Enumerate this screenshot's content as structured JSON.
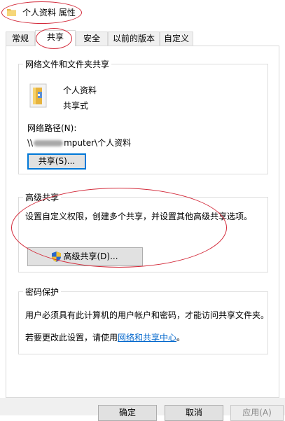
{
  "window": {
    "title": "个人资料 属性"
  },
  "tabs": [
    {
      "label": "常规"
    },
    {
      "label": "共享"
    },
    {
      "label": "安全"
    },
    {
      "label": "以前的版本"
    },
    {
      "label": "自定义"
    }
  ],
  "network_sharing": {
    "title": "网络文件和文件夹共享",
    "folder_name": "个人资料",
    "share_state": "共享式",
    "path_label": "网络路径(N):",
    "path_prefix": "\\\\",
    "path_suffix": "mputer\\个人资料",
    "share_button": "共享(S)..."
  },
  "advanced_sharing": {
    "title": "高级共享",
    "description": "设置自定义权限，创建多个共享，并设置其他高级共享选项。",
    "button": "高级共享(D)..."
  },
  "password_protection": {
    "title": "密码保护",
    "description": "用户必须具有此计算机的用户帐户和密码，才能访问共享文件夹。",
    "change_prefix": "若要更改此设置，请使用",
    "link": "网络和共享中心",
    "change_suffix": "。"
  },
  "footer": {
    "ok": "确定",
    "cancel": "取消",
    "apply": "应用(A)"
  },
  "colors": {
    "annotation": "#d32a3a",
    "link": "#0066cc",
    "focus": "#0078d7"
  }
}
